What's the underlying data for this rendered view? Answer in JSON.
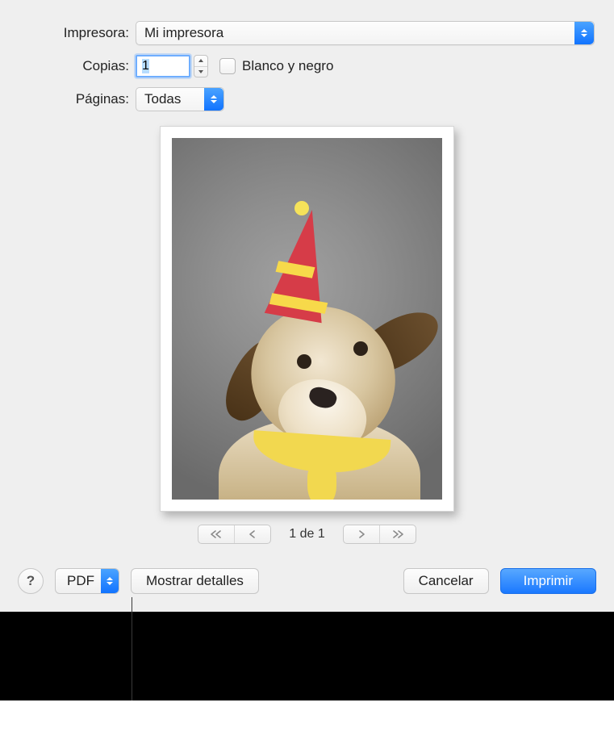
{
  "labels": {
    "printer": "Impresora:",
    "copies": "Copias:",
    "pages": "Páginas:",
    "bw": "Blanco y negro"
  },
  "printer": {
    "selected": "Mi impresora"
  },
  "copies": {
    "value": "1"
  },
  "pages": {
    "selected": "Todas"
  },
  "preview": {
    "counter": "1 de 1"
  },
  "buttons": {
    "help": "?",
    "pdf": "PDF",
    "details": "Mostrar detalles",
    "cancel": "Cancelar",
    "print": "Imprimir"
  }
}
